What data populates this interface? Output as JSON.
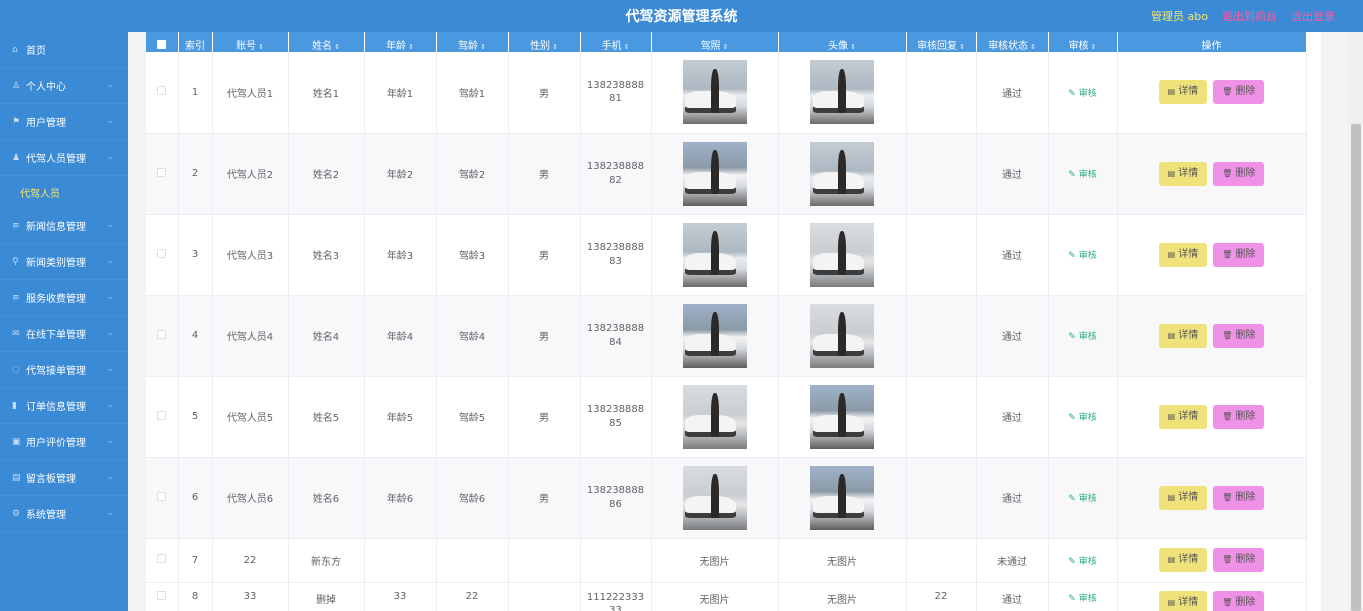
{
  "header": {
    "title": "代驾资源管理系统",
    "admin": "管理员 abo",
    "back_link": "退出到前台",
    "logout_link": "退出登录"
  },
  "sidebar": {
    "items": [
      {
        "label": "首页",
        "icon": "home-icon"
      },
      {
        "label": "个人中心",
        "icon": "user-icon"
      },
      {
        "label": "用户管理",
        "icon": "flag-icon"
      },
      {
        "label": "代驾人员管理",
        "icon": "person-icon"
      },
      {
        "label": "代驾人员",
        "icon": ""
      },
      {
        "label": "新闻信息管理",
        "icon": "list-icon"
      },
      {
        "label": "新闻类别管理",
        "icon": "location-icon"
      },
      {
        "label": "服务收费管理",
        "icon": "list-icon"
      },
      {
        "label": "在线下单管理",
        "icon": "mail-icon"
      },
      {
        "label": "代驾接单管理",
        "icon": "circle-icon"
      },
      {
        "label": "订单信息管理",
        "icon": "bookmark-icon"
      },
      {
        "label": "用户评价管理",
        "icon": "lock-icon"
      },
      {
        "label": "留言板管理",
        "icon": "message-icon"
      },
      {
        "label": "系统管理",
        "icon": "settings-icon"
      }
    ]
  },
  "table": {
    "headers": [
      "",
      "索引",
      "账号",
      "姓名",
      "年龄",
      "驾龄",
      "性别",
      "手机",
      "驾照",
      "头像",
      "审核回复",
      "审核状态",
      "审核",
      "操作"
    ],
    "audit_label": "审核",
    "detail_label": "详情",
    "delete_label": "删除",
    "no_image": "无图片",
    "rows": [
      {
        "idx": "1",
        "account": "代驾人员1",
        "name": "姓名1",
        "age": "年龄1",
        "drive_age": "驾龄1",
        "gender": "男",
        "phone": "13823888881",
        "reply": "",
        "status": "通过",
        "photo": true
      },
      {
        "idx": "2",
        "account": "代驾人员2",
        "name": "姓名2",
        "age": "年龄2",
        "drive_age": "驾龄2",
        "gender": "男",
        "phone": "13823888882",
        "reply": "",
        "status": "通过",
        "photo": true
      },
      {
        "idx": "3",
        "account": "代驾人员3",
        "name": "姓名3",
        "age": "年龄3",
        "drive_age": "驾龄3",
        "gender": "男",
        "phone": "13823888883",
        "reply": "",
        "status": "通过",
        "photo": true
      },
      {
        "idx": "4",
        "account": "代驾人员4",
        "name": "姓名4",
        "age": "年龄4",
        "drive_age": "驾龄4",
        "gender": "男",
        "phone": "13823888884",
        "reply": "",
        "status": "通过",
        "photo": true
      },
      {
        "idx": "5",
        "account": "代驾人员5",
        "name": "姓名5",
        "age": "年龄5",
        "drive_age": "驾龄5",
        "gender": "男",
        "phone": "13823888885",
        "reply": "",
        "status": "通过",
        "photo": true
      },
      {
        "idx": "6",
        "account": "代驾人员6",
        "name": "姓名6",
        "age": "年龄6",
        "drive_age": "驾龄6",
        "gender": "男",
        "phone": "13823888886",
        "reply": "",
        "status": "通过",
        "photo": true
      },
      {
        "idx": "7",
        "account": "22",
        "name": "新东方",
        "age": "",
        "drive_age": "",
        "gender": "",
        "phone": "",
        "reply": "",
        "status": "未通过",
        "photo": false
      },
      {
        "idx": "8",
        "account": "33",
        "name": "删掉",
        "age": "33",
        "drive_age": "22",
        "gender": "",
        "phone": "11122233333",
        "reply": "22",
        "status": "通过",
        "photo": false
      }
    ]
  },
  "colors": {
    "sidebar": "#3a8ad6",
    "header_row": "#4a98e0",
    "admin_text": "#f4e66a",
    "top_links": "#ff5aa0",
    "detail_button": "#f0e27a",
    "delete_button": "#f091e8",
    "audit_link": "#2ab27b"
  }
}
